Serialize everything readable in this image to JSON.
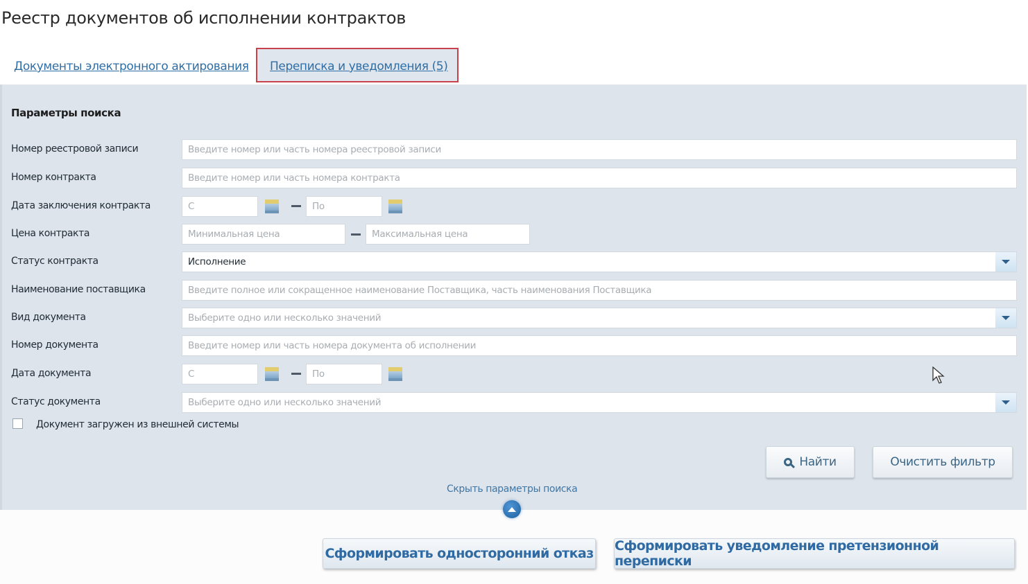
{
  "page": {
    "title": "Реестр документов об исполнении контрактов"
  },
  "tabs": [
    {
      "label": "Документы электронного актирования",
      "active": false
    },
    {
      "label": "Переписка и уведомления (5)",
      "active": true,
      "highlighted": true
    }
  ],
  "search": {
    "title": "Параметры поиска",
    "fields": {
      "registry_number": {
        "label": "Номер реестровой записи",
        "placeholder": "Введите номер или часть номера реестровой записи",
        "value": ""
      },
      "contract_number": {
        "label": "Номер контракта",
        "placeholder": "Введите номер или часть номера контракта",
        "value": ""
      },
      "contract_date": {
        "label": "Дата заключения контракта",
        "from_placeholder": "С",
        "to_placeholder": "По"
      },
      "contract_price": {
        "label": "Цена контракта",
        "min_placeholder": "Минимальная цена",
        "max_placeholder": "Максимальная цена"
      },
      "contract_status": {
        "label": "Статус контракта",
        "value": "Исполнение"
      },
      "supplier_name": {
        "label": "Наименование поставщика",
        "placeholder": "Введите  полное или сокращенное наименование Поставщика, часть наименования Поставщика",
        "value": ""
      },
      "document_type": {
        "label": "Вид документа",
        "placeholder": "Выберите одно или несколько значений"
      },
      "document_number": {
        "label": "Номер документа",
        "placeholder": "Введите номер или часть номера документа об исполнении",
        "value": ""
      },
      "document_date": {
        "label": "Дата документа",
        "from_placeholder": "С",
        "to_placeholder": "По"
      },
      "document_status": {
        "label": "Статус документа",
        "placeholder": "Выберите одно или несколько значений"
      },
      "external_system": {
        "label": "Документ загружен из внешней системы",
        "checked": false
      }
    },
    "find_label": "Найти",
    "clear_label": "Очистить фильтр",
    "hide_label": "Скрыть параметры поиска"
  },
  "actions": {
    "unilateral_refusal": "Сформировать односторонний отказ",
    "claim_notification": "Сформировать уведомление претензионной переписки"
  },
  "colors": {
    "accent": "#2f6aa3",
    "highlight_border": "#c8414b",
    "panel_bg": "#dde4ec"
  }
}
